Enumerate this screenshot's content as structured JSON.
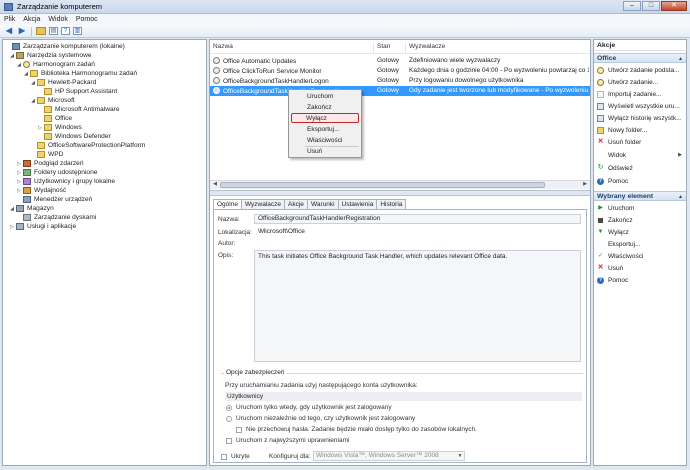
{
  "window": {
    "title": "Zarządzanie komputerem",
    "min": "–",
    "max": "□",
    "close": "✕"
  },
  "menu": [
    "Plik",
    "Akcja",
    "Widok",
    "Pomoc"
  ],
  "tree": [
    {
      "label": "Zarządzanie komputerem (lokalne)",
      "toggle": "",
      "icon": "computer-icon"
    },
    {
      "label": "Narzędzia systemowe",
      "toggle": "◢",
      "icon": "tools-icon"
    },
    {
      "label": "Harmonogram zadań",
      "toggle": "◢",
      "icon": "clock-icon"
    },
    {
      "label": "Biblioteka Harmonogramu zadań",
      "toggle": "◢",
      "icon": "folder-icon"
    },
    {
      "label": "Hewlett-Packard",
      "toggle": "◢",
      "icon": "folder-icon"
    },
    {
      "label": "HP Support Assistant",
      "toggle": "",
      "icon": "folder-icon"
    },
    {
      "label": "Microsoft",
      "toggle": "◢",
      "icon": "folder-icon"
    },
    {
      "label": "Microsoft Antimalware",
      "toggle": "",
      "icon": "folder-icon"
    },
    {
      "label": "Office",
      "toggle": "",
      "icon": "folder-icon"
    },
    {
      "label": "Windows",
      "toggle": "▷",
      "icon": "folder-icon"
    },
    {
      "label": "Windows Defender",
      "toggle": "",
      "icon": "folder-icon"
    },
    {
      "label": "OfficeSoftwareProtectionPlatform",
      "toggle": "",
      "icon": "folder-icon"
    },
    {
      "label": "WPD",
      "toggle": "",
      "icon": "folder-icon"
    },
    {
      "label": "Podgląd zdarzeń",
      "toggle": "▷",
      "icon": "event-viewer-icon"
    },
    {
      "label": "Foldery udostępnione",
      "toggle": "▷",
      "icon": "shared-folder-icon"
    },
    {
      "label": "Użytkownicy i grupy lokalne",
      "toggle": "▷",
      "icon": "users-icon"
    },
    {
      "label": "Wydajność",
      "toggle": "▷",
      "icon": "performance-icon"
    },
    {
      "label": "Menedżer urządzeń",
      "toggle": "",
      "icon": "device-manager-icon"
    },
    {
      "label": "Magazyn",
      "toggle": "◢",
      "icon": "storage-icon"
    },
    {
      "label": "Zarządzanie dyskami",
      "toggle": "",
      "icon": "disk-icon"
    },
    {
      "label": "Usługi i aplikacje",
      "toggle": "▷",
      "icon": "services-icon"
    }
  ],
  "list": {
    "columns": [
      "Nazwa",
      "Stan",
      "Wyzwalacze"
    ],
    "rows": [
      {
        "name": "Office Automatic Updates",
        "state": "Gotowy",
        "trigger": "Zdefiniowano wiele wyzwalaczy"
      },
      {
        "name": "Office ClickToRun Service Monitor",
        "state": "Gotowy",
        "trigger": "Każdego dnia o godzinie 04:00 - Po wyzwoleniu powtarzaj co 1.00:00"
      },
      {
        "name": "OfficeBackgroundTaskHandlerLogon",
        "state": "Gotowy",
        "trigger": "Przy logowaniu dowolnego użytkownika"
      },
      {
        "name": "OfficeBackgroundTaskHandlerRegistration",
        "state": "Gotowy",
        "trigger": "Gdy zadanie jest tworzone lub modyfikowane - Po wyzwoleniu powtarzaj"
      }
    ]
  },
  "context_menu": [
    "Uruchom",
    "Zakończ",
    "Wyłącz",
    "Eksportuj...",
    "Właściwości",
    "Usuń"
  ],
  "detail": {
    "tabs": [
      "Ogólne",
      "Wyzwalacze",
      "Akcje",
      "Warunki",
      "Ustawienia",
      "Historia"
    ],
    "name_label": "Nazwa:",
    "name_value": "OfficeBackgroundTaskHandlerRegistration",
    "location_label": "Lokalizacja:",
    "location_value": "\\Microsoft\\Office",
    "author_label": "Autor:",
    "author_value": "",
    "desc_label": "Opis:",
    "desc_value": "This task initiates Office Background Task Handler, which updates relevant Office data.",
    "security_title": "Opcje zabezpieczeń",
    "account_prompt": "Przy uruchamianiu zadania użyj następującego konta użytkownika:",
    "account_value": "Użytkownicy",
    "radio_logged": "Uruchom tylko wtedy, gdy użytkownik jest zalogowany",
    "radio_any": "Uruchom niezależnie od tego, czy użytkownik jest zalogowany",
    "no_password": "Nie przechowuj hasła. Zadanie będzie miało dostęp tylko do zasobów lokalnych.",
    "highest": "Uruchom z najwyższymi uprawnieniami",
    "hidden": "Ukryte",
    "configure_label": "Konfiguruj dla:",
    "configure_value": "Windows Vista™, Windows Server™ 2008"
  },
  "actions": {
    "header": "Akcje",
    "section1": "Office",
    "items1": [
      {
        "label": "Utwórz zadanie podsta...",
        "icon": "clock-icon"
      },
      {
        "label": "Utwórz zadanie...",
        "icon": "clock-icon"
      },
      {
        "label": "Importuj zadanie...",
        "icon": "import-icon"
      },
      {
        "label": "Wyświetl wszystkie uru...",
        "icon": "list-icon"
      },
      {
        "label": "Wyłącz historię wszystk...",
        "icon": "list-icon"
      },
      {
        "label": "Nowy folder...",
        "icon": "folder-icon"
      },
      {
        "label": "Usuń folder",
        "icon": "delete-icon"
      },
      {
        "label": "Widok",
        "icon": "view-icon"
      },
      {
        "label": "Odśwież",
        "icon": "refresh-icon"
      },
      {
        "label": "Pomoc",
        "icon": "help-icon"
      }
    ],
    "section2": "Wybrany element",
    "items2": [
      {
        "label": "Uruchom",
        "icon": "play-icon"
      },
      {
        "label": "Zakończ",
        "icon": "stop-icon"
      },
      {
        "label": "Wyłącz",
        "icon": "disable-icon"
      },
      {
        "label": "Eksportuj...",
        "icon": "export-icon"
      },
      {
        "label": "Właściwości",
        "icon": "properties-icon"
      },
      {
        "label": "Usuń",
        "icon": "delete-icon"
      },
      {
        "label": "Pomoc",
        "icon": "help-icon"
      }
    ]
  }
}
